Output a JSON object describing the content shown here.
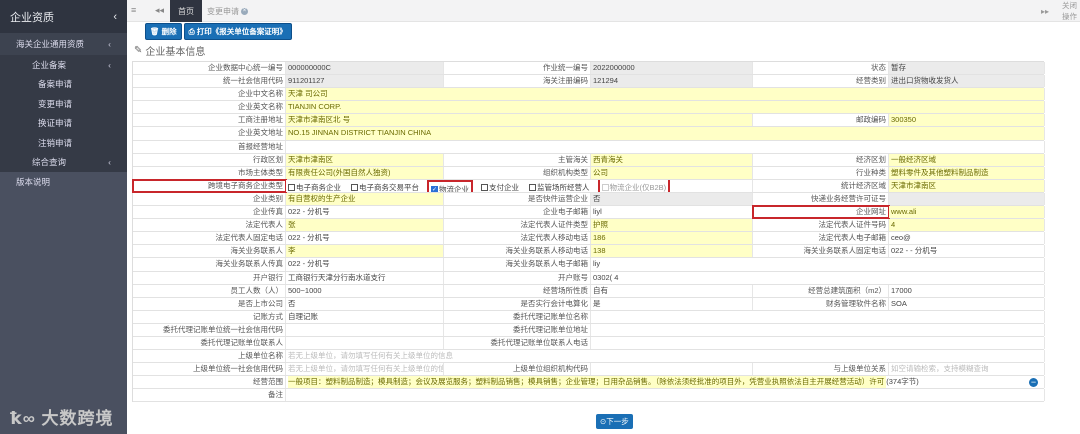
{
  "sidebar": {
    "header": "企业资质",
    "items": [
      {
        "label": "海关企业通用资质",
        "level": 1,
        "chevron": true
      },
      {
        "label": "企业备案",
        "level": 2,
        "chevron": true
      },
      {
        "label": "备案申请",
        "level": 3
      },
      {
        "label": "变更申请",
        "level": 3
      },
      {
        "label": "换证申请",
        "level": 3
      },
      {
        "label": "注销申请",
        "level": 3
      },
      {
        "label": "综合查询",
        "level": 2,
        "chevron": true
      },
      {
        "label": "版本说明",
        "level": 0
      }
    ]
  },
  "topbar": {
    "tabs": [
      {
        "label": "首页"
      },
      {
        "label": "变更申请"
      }
    ],
    "close_label": "关闭操作"
  },
  "toolbar": {
    "delete_label": "删除",
    "print_label": "打印《报关单位备案证明》"
  },
  "section_title": "企业基本信息",
  "form": {
    "rows": [
      [
        {
          "l": "企业数据中心统一编号",
          "v": "000000000C",
          "bg": "g"
        },
        {
          "l": "作业统一编号",
          "v": "2022000000",
          "bg": "g"
        },
        {
          "l": "状态",
          "v": "暂存",
          "bg": "g"
        }
      ],
      [
        {
          "l": "统一社会信用代码",
          "v": "911201127",
          "bg": "g"
        },
        {
          "l": "海关注册编码",
          "v": "121294",
          "bg": "g"
        },
        {
          "l": "经营类别",
          "v": "进出口货物收发货人",
          "bg": "g"
        }
      ],
      [
        {
          "l": "企业中文名称",
          "v": "天津                    司公司",
          "bg": "y"
        }
      ],
      [
        {
          "l": "企业英文名称",
          "v": "TIANJIN                       CORP.",
          "bg": "y"
        }
      ],
      [
        {
          "l": "工商注册地址",
          "v": "天津市津南区北                              号",
          "bg": "y"
        },
        {
          "l": "邮政编码",
          "v": "300350",
          "bg": "y"
        }
      ],
      [
        {
          "l": "企业英文地址",
          "v": "NO.15                                                                                 JINNAN DISTRICT TIANJIN CHINA",
          "bg": "y"
        }
      ],
      [
        {
          "l": "首报经营地址",
          "v": "",
          "bg": "w"
        }
      ],
      [
        {
          "l": "行政区划",
          "v": "天津市津南区",
          "bg": "y"
        },
        {
          "l": "主管海关",
          "v": "西青海关",
          "bg": "y"
        },
        {
          "l": "经济区划",
          "v": "一般经济区域",
          "bg": "y"
        }
      ],
      [
        {
          "l": "市场主体类型",
          "v": "有限责任公司(外国自然人独资)",
          "bg": "y"
        },
        {
          "l": "组织机构类型",
          "v": "公司",
          "bg": "y"
        },
        {
          "l": "行业种类",
          "v": "塑料零件及其他塑料制品制造",
          "bg": "y"
        }
      ],
      [
        {
          "l": "跨境电子商务企业类型",
          "checks": [
            {
              "label": "电子商务企业",
              "checked": false
            },
            {
              "label": "电子商务交易平台",
              "checked": false
            },
            {
              "label": "物流企业",
              "checked": true
            },
            {
              "label": "支付企业",
              "checked": false
            },
            {
              "label": "监管场所经营人",
              "checked": false
            },
            {
              "label": "物流企业(仅B2B)",
              "checked": false
            }
          ]
        },
        {
          "l": "统计经济区域",
          "v": "天津市津南区",
          "bg": "y"
        }
      ],
      [
        {
          "l": "企业类别",
          "v": "有自营权的生产企业",
          "bg": "y"
        },
        {
          "l": "是否快件运营企业",
          "v": "否",
          "bg": "g"
        },
        {
          "l": "快递业务经营许可证号",
          "v": "",
          "bg": "g"
        }
      ],
      [
        {
          "l": "企业传真",
          "v": "022   -                              分机号",
          "bg": "w"
        },
        {
          "l": "企业电子邮箱",
          "v": "liyl",
          "bg": "w"
        },
        {
          "l": "企业网址",
          "v": "www.ali",
          "bg": "y"
        }
      ],
      [
        {
          "l": "法定代表人",
          "v": "张",
          "bg": "y"
        },
        {
          "l": "法定代表人证件类型",
          "v": "护照",
          "bg": "y"
        },
        {
          "l": "法定代表人证件号码",
          "v": "4",
          "bg": "y"
        }
      ],
      [
        {
          "l": "法定代表人固定电话",
          "v": "022   -                              分机号",
          "bg": "w"
        },
        {
          "l": "法定代表人移动电话",
          "v": "186",
          "bg": "y"
        },
        {
          "l": "法定代表人电子邮箱",
          "v": "ceo@",
          "bg": "w"
        }
      ],
      [
        {
          "l": "海关业务联系人",
          "v": "李",
          "bg": "y"
        },
        {
          "l": "海关业务联系人移动电话",
          "v": "138",
          "bg": "y"
        },
        {
          "l": "海关业务联系人固定电话",
          "v": "022   -            -         分机号",
          "bg": "w"
        }
      ],
      [
        {
          "l": "海关业务联系人传真",
          "v": "022   -                              分机号",
          "bg": "w"
        },
        {
          "l": "海关业务联系人电子邮箱",
          "v": "liy",
          "bg": "w"
        }
      ],
      [
        {
          "l": "开户银行",
          "v": "工商银行天津分行南水道支行",
          "bg": "w"
        },
        {
          "l": "开户账号",
          "v": "0302(                4",
          "bg": "w"
        }
      ],
      [
        {
          "l": "员工人数（人）",
          "v": "500~1000",
          "bg": "w"
        },
        {
          "l": "经营场所性质",
          "v": "自有",
          "bg": "w"
        },
        {
          "l": "经营总建筑面积（m2）",
          "v": "17000",
          "bg": "w"
        }
      ],
      [
        {
          "l": "是否上市公司",
          "v": "否",
          "bg": "w"
        },
        {
          "l": "是否实行会计电算化",
          "v": "是",
          "bg": "w"
        },
        {
          "l": "财务管理软件名称",
          "v": "SOA",
          "bg": "w"
        }
      ],
      [
        {
          "l": "记账方式",
          "v": "自理记账",
          "bg": "w"
        },
        {
          "l": "委托代理记账单位名称",
          "v": "",
          "bg": "w"
        }
      ],
      [
        {
          "l": "委托代理记账单位统一社会信用代码",
          "v": "",
          "bg": "w"
        },
        {
          "l": "委托代理记账单位地址",
          "v": "",
          "bg": "w"
        }
      ],
      [
        {
          "l": "委托代理记账单位联系人",
          "v": "",
          "bg": "w"
        },
        {
          "l": "委托代理记账单位联系人电话",
          "v": "",
          "bg": "w"
        }
      ],
      [
        {
          "l": "上级单位名称",
          "v": "",
          "ph": "若无上级单位，请勿填写任何有关上级单位的信息",
          "bg": "w"
        }
      ],
      [
        {
          "l": "上级单位统一社会信用代码",
          "v": "",
          "ph": "若无上级单位，请勿填写任何有关上级单位的信息",
          "bg": "w"
        },
        {
          "l": "上级单位组织机构代码",
          "v": "",
          "bg": "w"
        },
        {
          "l": "与上级单位关系",
          "v": "",
          "ph": "如空请输检索，支持模糊查询",
          "bg": "w"
        }
      ],
      [
        {
          "l": "经营范围",
          "v": "一般项目：塑料制品制造；模具制造；会议及展览服务；塑料制品销售；模具销售；企业管理；日用杂品销售。（除依法须经批准的项目外，凭营业执照依法自主开展经营活动）许可",
          "count": "(374字节)",
          "bg": "y"
        }
      ],
      [
        {
          "l": "备注",
          "v": "",
          "bg": "w"
        }
      ]
    ]
  },
  "next_label": "下一步",
  "watermark": "大数跨境"
}
